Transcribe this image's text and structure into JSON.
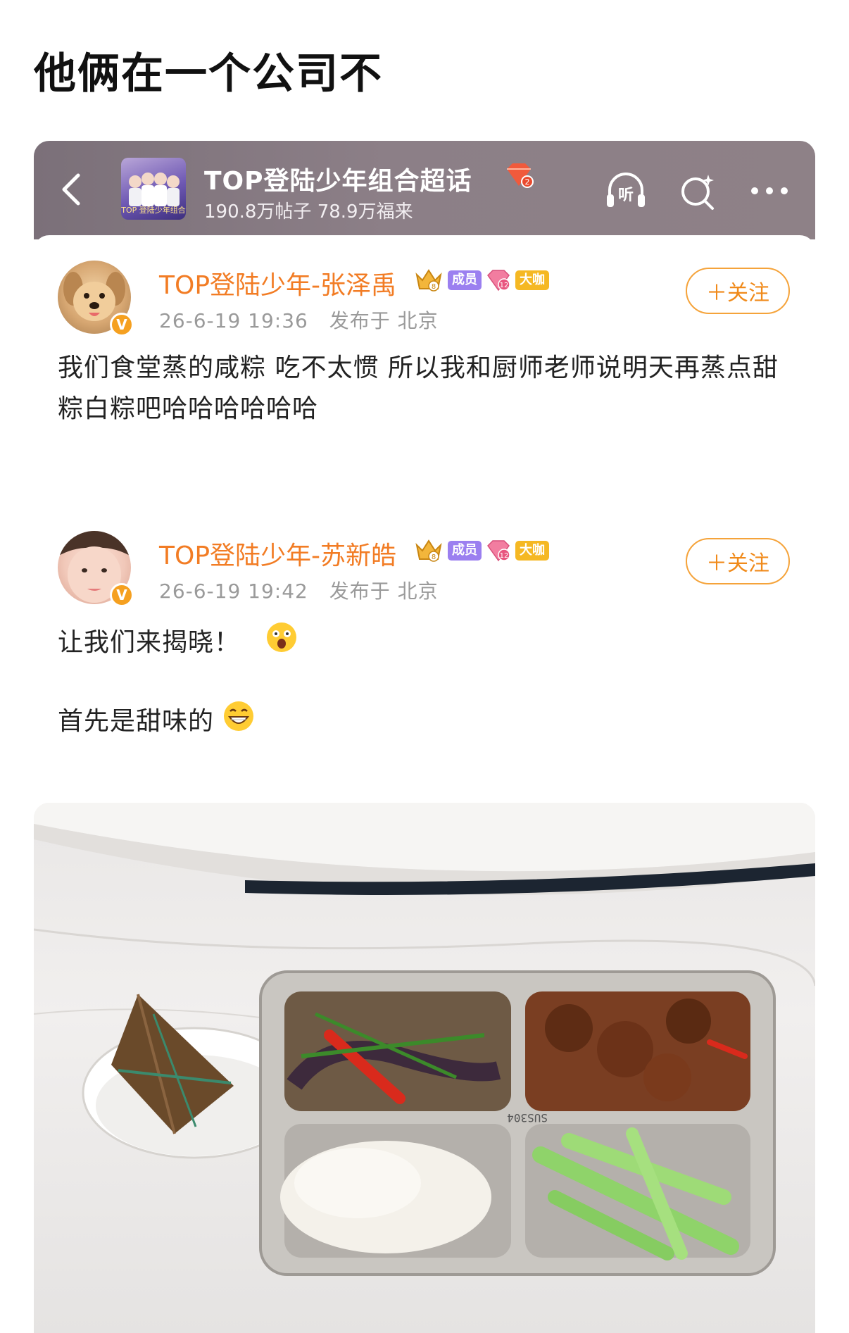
{
  "page": {
    "title": "他俩在一个公司不"
  },
  "topic": {
    "name": "TOP登陆少年组合超话",
    "level": "2",
    "stats": "190.8万帖子 78.9万福来",
    "cover_text": "TOP 登陆少年组合",
    "icons": {
      "back": "chevron-left-icon",
      "listen": "headphones-icon",
      "listen_label": "听",
      "search": "search-sparkle-icon",
      "more": "more-dots-icon"
    }
  },
  "posts": [
    {
      "user": "TOP登陆少年-张泽禹",
      "crown_level": "8",
      "member_tag": "成员",
      "gem_level": "12",
      "bigshot_tag": "大咖",
      "verified": "V",
      "time": "26-6-19 19:36",
      "location": "发布于 北京",
      "follow_label": "＋关注",
      "text": "我们食堂蒸的咸粽 吃不太惯 所以我和厨师老师说明天再蒸点甜粽白粽吧哈哈哈哈哈哈"
    },
    {
      "user": "TOP登陆少年-苏新皓",
      "crown_level": "8",
      "member_tag": "成员",
      "gem_level": "12",
      "bigshot_tag": "大咖",
      "verified": "V",
      "time": "26-6-19 19:42",
      "location": "发布于 北京",
      "follow_label": "＋关注",
      "line1": "让我们来揭晓！",
      "line2": "首先是甜味的"
    }
  ],
  "photo": {
    "tray_stamp": "SUS304",
    "colors": {
      "table": "#ecebea",
      "tray": "#b9b5b0",
      "rice": "#f4f1ea",
      "celery": "#8fd36a",
      "meat": "#7a3e22"
    }
  }
}
